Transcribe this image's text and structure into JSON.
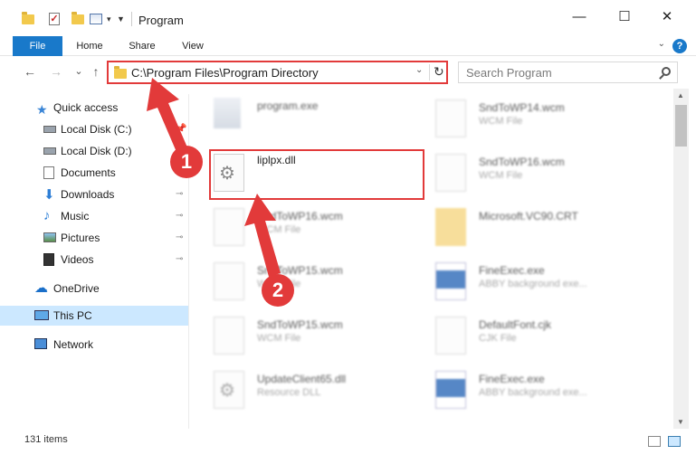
{
  "window": {
    "title": "Program",
    "minimize": "—",
    "maximize": "☐",
    "close": "✕"
  },
  "ribbon": {
    "tabs": [
      "File",
      "Home",
      "Share",
      "View"
    ],
    "help": "?"
  },
  "address": {
    "path": "C:\\Program Files\\Program Directory",
    "refresh_glyph": "↻",
    "dropdown_glyph": "⌄"
  },
  "search": {
    "placeholder": "Search Program"
  },
  "nav": {
    "back": "←",
    "forward": "→",
    "recent": "⌄",
    "up": "↑"
  },
  "sidebar": {
    "items": [
      {
        "label": "Quick access",
        "icon": "star-icon"
      },
      {
        "label": "Local Disk (C:)",
        "icon": "drive-icon"
      },
      {
        "label": "Local Disk (D:)",
        "icon": "drive-icon"
      },
      {
        "label": "Documents",
        "icon": "documents-icon"
      },
      {
        "label": "Downloads",
        "icon": "download-icon"
      },
      {
        "label": "Music",
        "icon": "music-icon"
      },
      {
        "label": "Pictures",
        "icon": "pictures-icon"
      },
      {
        "label": "Videos",
        "icon": "videos-icon"
      },
      {
        "label": "OneDrive",
        "icon": "cloud-icon"
      },
      {
        "label": "This PC",
        "icon": "computer-icon"
      },
      {
        "label": "Network",
        "icon": "network-icon"
      }
    ]
  },
  "files": {
    "left": [
      {
        "name": "program.exe",
        "type": ""
      },
      {
        "name": "liplpx.dll",
        "type": ""
      },
      {
        "name": "SndToWP16.wcm",
        "type": "WCM File"
      },
      {
        "name": "SndToWP15.wcm",
        "type": "WCM File"
      },
      {
        "name": "SndToWP15.wcm",
        "type": "WCM File"
      },
      {
        "name": "UpdateClient65.dll",
        "type": "Resource DLL"
      }
    ],
    "right": [
      {
        "name": "SndToWP14.wcm",
        "type": "WCM File"
      },
      {
        "name": "SndToWP16.wcm",
        "type": "WCM File"
      },
      {
        "name": "Microsoft.VC90.CRT",
        "type": ""
      },
      {
        "name": "FineExec.exe",
        "type": "ABBY background exe..."
      },
      {
        "name": "DefaultFont.cjk",
        "type": "CJK File"
      },
      {
        "name": "FineExec.exe",
        "type": "ABBY background exe..."
      }
    ]
  },
  "status": {
    "count": "131 items"
  },
  "annotations": {
    "step1": "1",
    "step2": "2",
    "color": "#e23a3a"
  }
}
